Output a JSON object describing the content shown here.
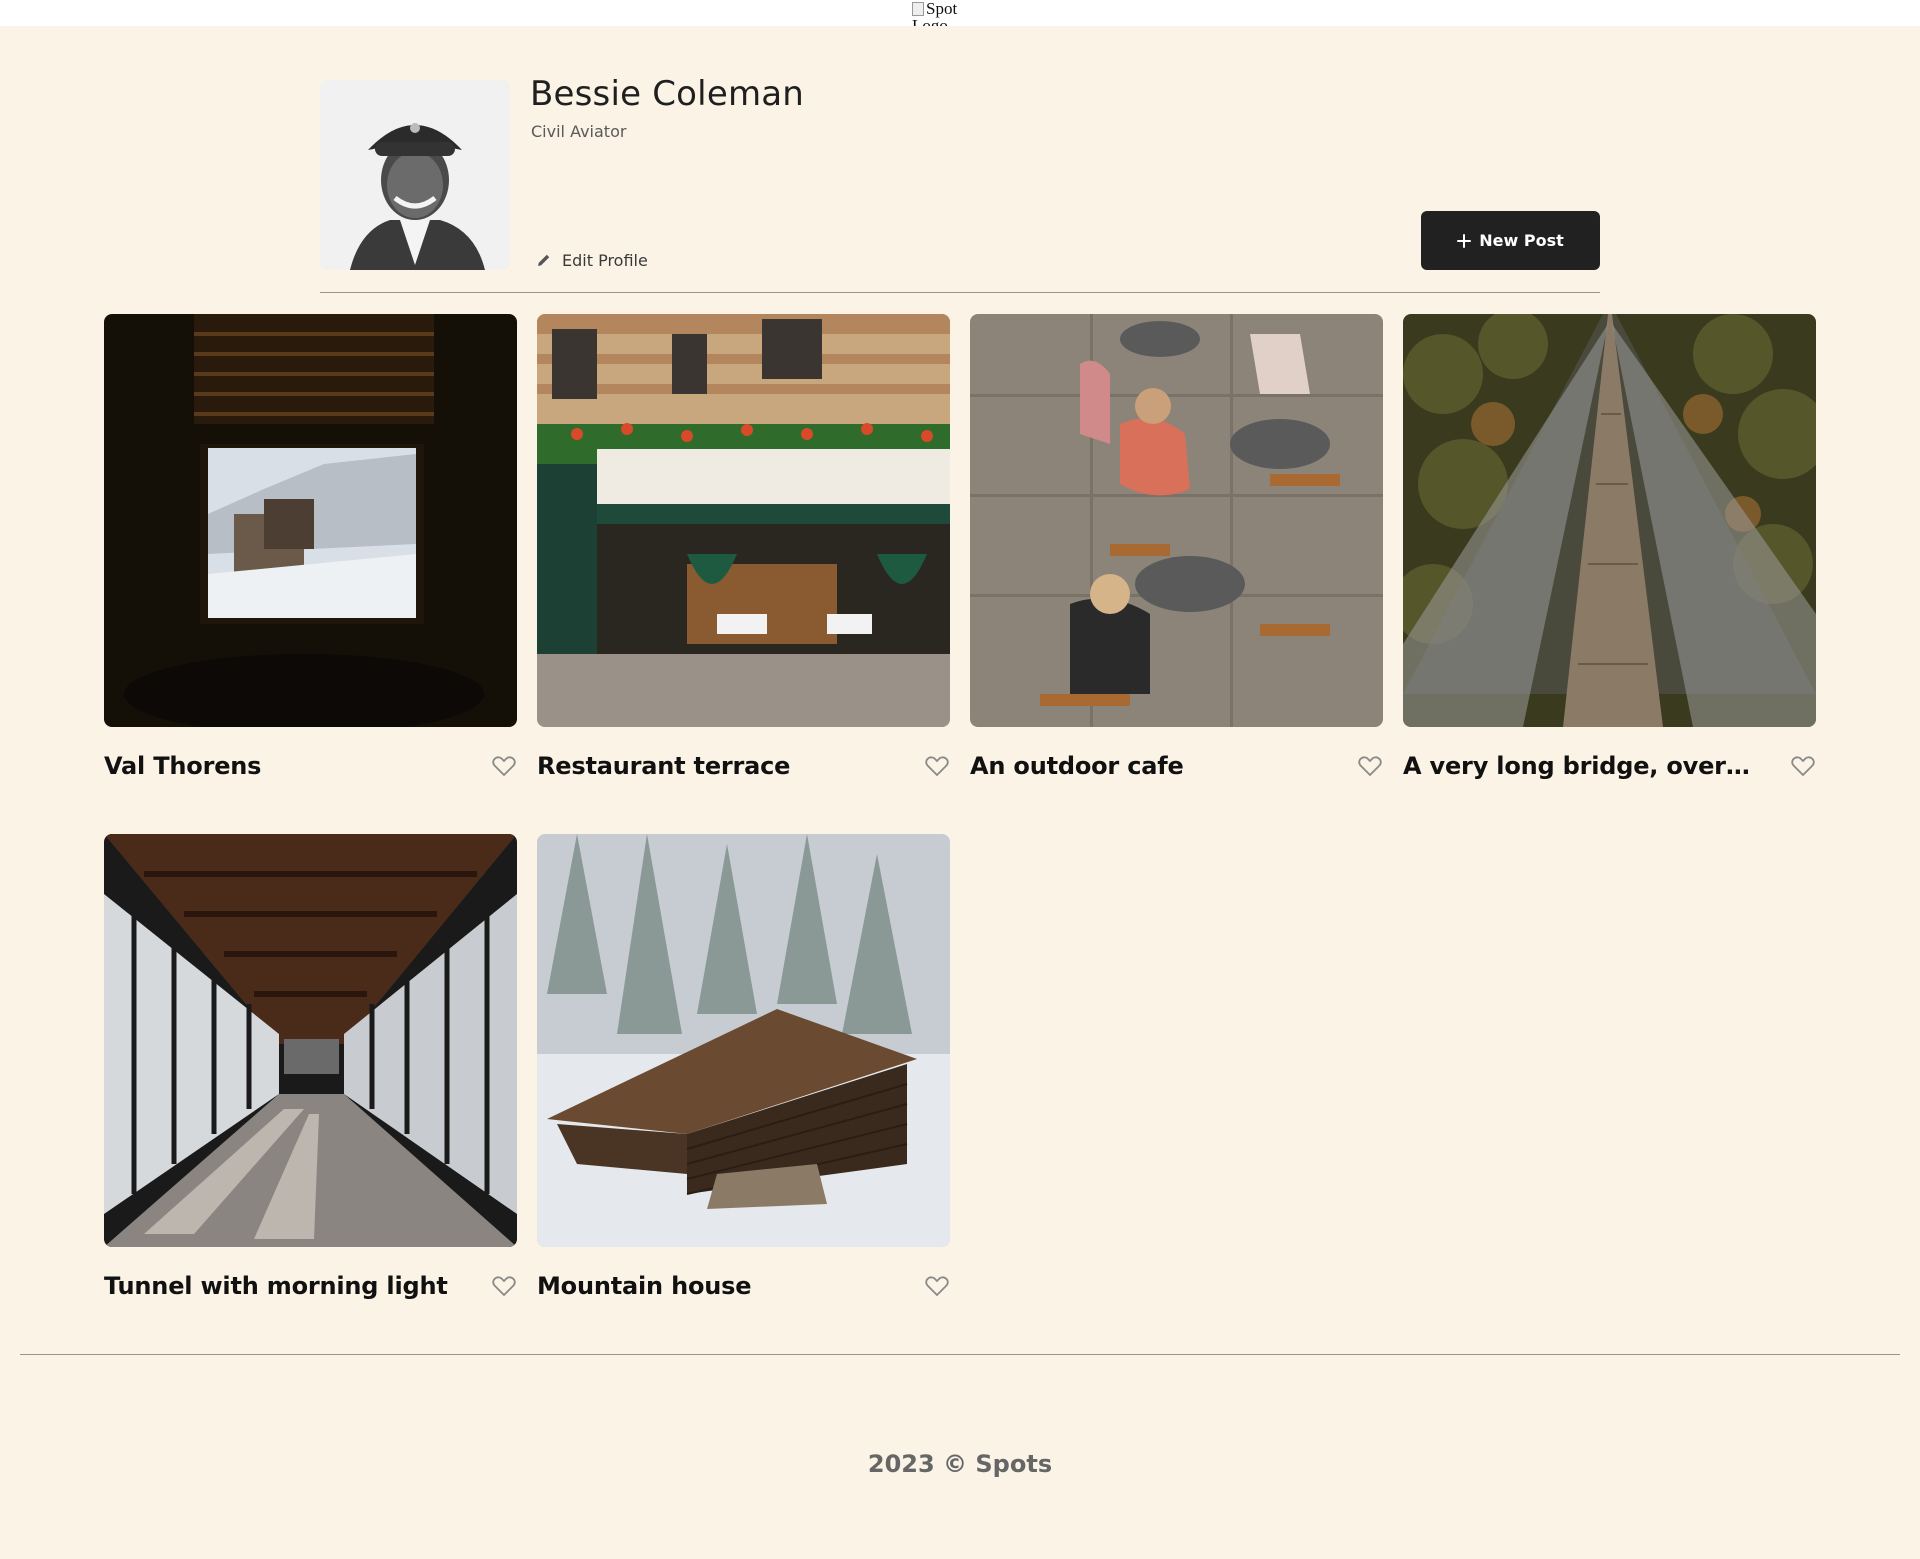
{
  "header": {
    "logo_alt": "Spot Logo"
  },
  "profile": {
    "name": "Bessie Coleman",
    "description": "Civil Aviator",
    "edit_label": "Edit Profile",
    "new_post_label": "New Post"
  },
  "cards": [
    {
      "title": "Val Thorens"
    },
    {
      "title": "Restaurant terrace"
    },
    {
      "title": "An outdoor cafe"
    },
    {
      "title": "A very long bridge, over the forest and through the trees"
    },
    {
      "title": "Tunnel with morning light"
    },
    {
      "title": "Mountain house"
    }
  ],
  "footer": {
    "text": "2023 © Spots"
  },
  "colors": {
    "page_background": "#FAF3E6",
    "button_dark": "#212121",
    "divider": "#9A9489",
    "footer_text": "#666666"
  },
  "icons": {
    "edit": "pencil-icon",
    "new_post": "plus-icon",
    "like": "heart-outline-icon"
  }
}
